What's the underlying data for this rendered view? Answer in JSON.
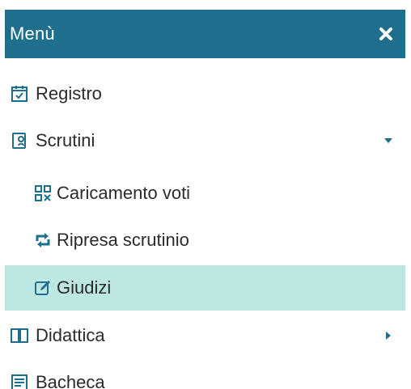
{
  "header": {
    "title": "Menù",
    "close_icon": "close-icon"
  },
  "colors": {
    "header_bg": "#1e6f8e",
    "active_bg": "#bde7e2",
    "icon_blue": "#1e6f8e",
    "text": "#2b2b2b"
  },
  "menu": {
    "items": [
      {
        "label": "Registro",
        "icon": "calendar-check-icon"
      },
      {
        "label": "Scrutini",
        "icon": "report-icon",
        "expanded": true
      },
      {
        "label": "Caricamento voti",
        "icon": "grid-icon"
      },
      {
        "label": "Ripresa scrutinio",
        "icon": "retweet-icon"
      },
      {
        "label": "Giudizi",
        "icon": "edit-icon",
        "selected": true
      },
      {
        "label": "Didattica",
        "icon": "book-icon",
        "expanded": false
      },
      {
        "label": "Bacheca",
        "icon": "board-icon"
      }
    ]
  }
}
